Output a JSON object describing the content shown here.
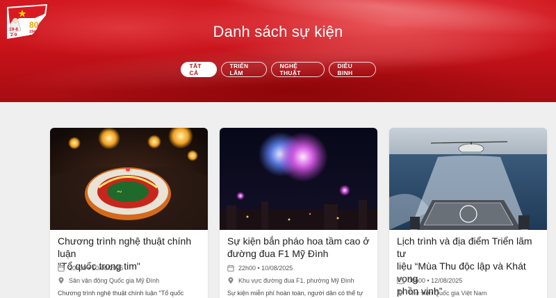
{
  "header": {
    "title": "Danh sách sự kiện",
    "logo": {
      "line1": "19-8",
      "line2": "2-9",
      "line3": "1945",
      "line4": "2025",
      "number": "80"
    }
  },
  "tabs": [
    {
      "label": "TẤT CẢ",
      "active": true
    },
    {
      "label": "TRIỂN LÃM",
      "active": false
    },
    {
      "label": "NGHỆ THUẬT",
      "active": false
    },
    {
      "label": "DIỄU BINH",
      "active": false
    }
  ],
  "events": [
    {
      "title_line1": "Chương trình nghệ thuật chính luận",
      "title_line2": "\"Tổ quốc trong tim\"",
      "title_line3": "",
      "time": "20h00 • 10/08/2025",
      "location": "Sân vận động Quốc gia Mỹ Đình",
      "description": "Chương trình nghệ thuật chính luận \"Tổ quốc",
      "image": "stadium-fireworks"
    },
    {
      "title_line1": "Sự kiện bắn pháo hoa tầm cao ở",
      "title_line2": "đường đua F1 Mỹ Đình",
      "title_line3": "",
      "time": "22h00 • 10/08/2025",
      "location": "Khu vực đường đua F1, phường Mỹ Đình",
      "description": "Sự kiện miễn phí hoàn toàn, người dân có thể tự",
      "image": "night-fireworks"
    },
    {
      "title_line1": "Lịch trình và địa điểm Triển lãm tư",
      "title_line2": "liệu “Mùa Thu độc lập và Khát vọng",
      "title_line3": "phồn vinh”",
      "time": "08h00 • 12/08/2025",
      "location": "Thư viện Quốc gia Việt Nam",
      "description": "",
      "image": "helicopter-ship"
    }
  ],
  "colors": {
    "brand": "#c9121a",
    "accent": "#b4141b",
    "background": "#efefef"
  }
}
